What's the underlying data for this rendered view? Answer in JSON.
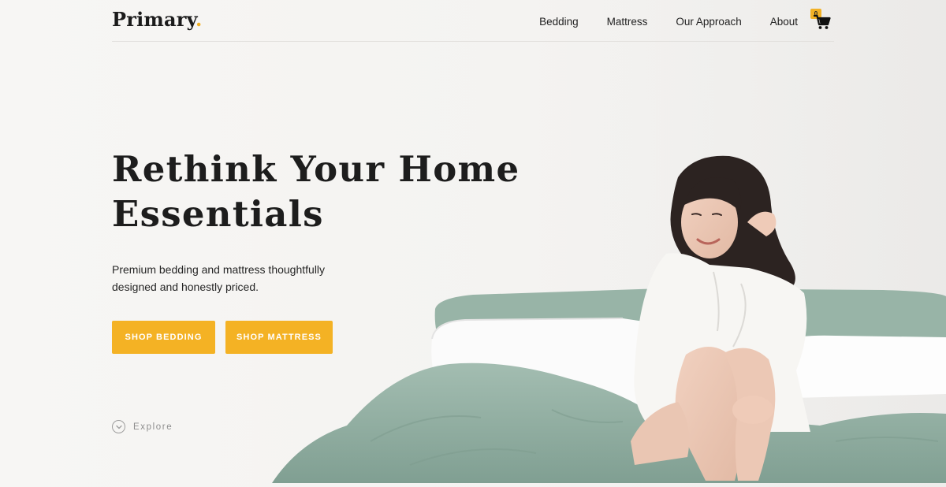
{
  "header": {
    "logo_text": "Primary",
    "logo_dot": ".",
    "nav": [
      "Bedding",
      "Mattress",
      "Our Approach",
      "About"
    ],
    "cart_count": "0",
    "cart_icon": "shopping-cart-icon"
  },
  "hero": {
    "title": "Rethink Your Home\nEssentials",
    "subtitle": "Premium bedding and mattress thoughtfully designed and honestly priced.",
    "buttons": {
      "shop_bedding": "SHOP BEDDING",
      "shop_mattress": "SHOP MATTRESS"
    },
    "explore_label": "Explore",
    "explore_icon": "chevron-down-circle-icon",
    "image": "woman-sitting-on-bed-illustration"
  },
  "colors": {
    "accent": "#f4b224",
    "text": "#1d1d1d",
    "sheets": "#8fac9f",
    "pillows": "#ffffff",
    "background": "#f4f3f1"
  }
}
